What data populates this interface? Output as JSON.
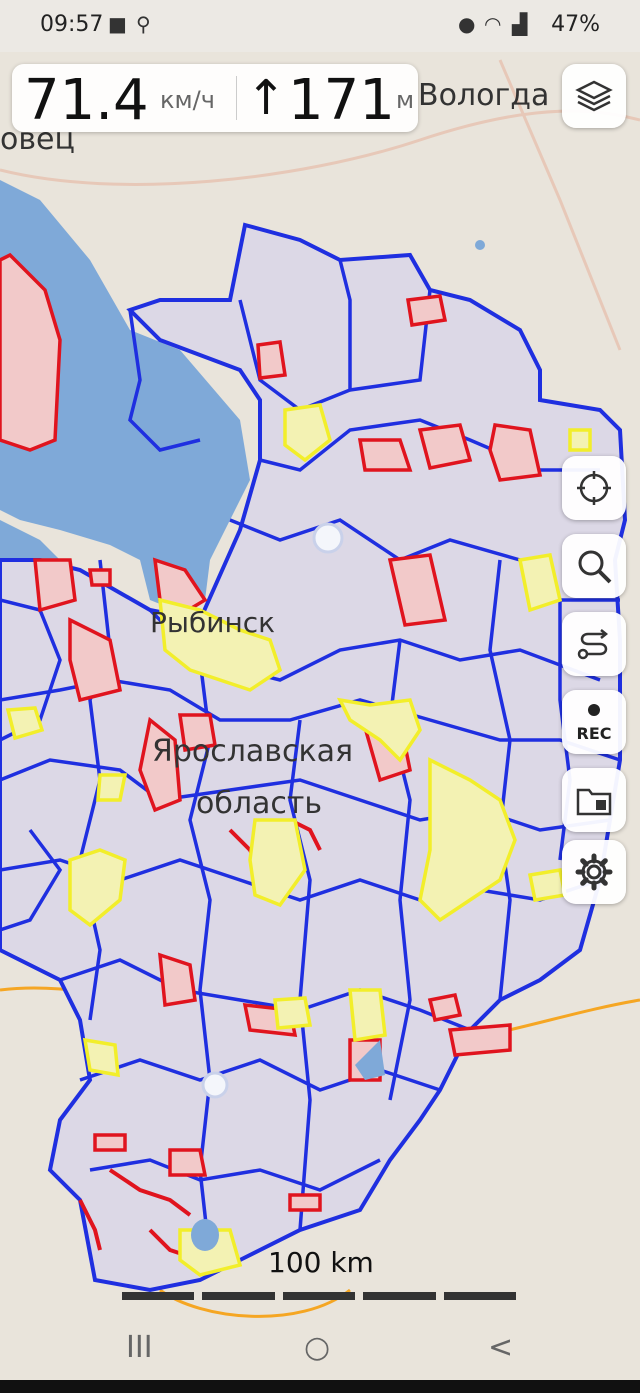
{
  "status_bar": {
    "time": "09:57",
    "battery": "47%"
  },
  "speed_panel": {
    "speed_value": "71.4",
    "speed_unit": "км/ч",
    "altitude_arrow": "↑",
    "altitude_value": "171",
    "altitude_unit": "м"
  },
  "map": {
    "labels": {
      "city_vologda": "Вологда",
      "city_cherepovets_partial": "овец",
      "city_rybinsk": "Рыбинск",
      "region_line1": "Ярославская",
      "region_line2": "область"
    },
    "scale_label": "100 km",
    "colors": {
      "water": "#7fa9d8",
      "land": "#e9e4db",
      "region_fill": "#dcd8e6",
      "boundary_blue": "#1f2fe0",
      "protected_red": "#e0141e",
      "settlement_yellow": "#f2ee2a",
      "roads_orange": "#f5a623"
    }
  },
  "right_toolbar": {
    "buttons": [
      {
        "name": "layers",
        "icon": "layers-icon"
      },
      {
        "name": "locate",
        "icon": "crosshair-icon"
      },
      {
        "name": "search",
        "icon": "search-icon"
      },
      {
        "name": "route",
        "icon": "route-icon"
      },
      {
        "name": "record",
        "icon": "record-icon",
        "label": "REC"
      },
      {
        "name": "tracks",
        "icon": "folder-map-icon"
      },
      {
        "name": "settings",
        "icon": "gear-icon"
      }
    ]
  },
  "nav_bar": {
    "recent": "III",
    "home": "○",
    "back": "<"
  }
}
